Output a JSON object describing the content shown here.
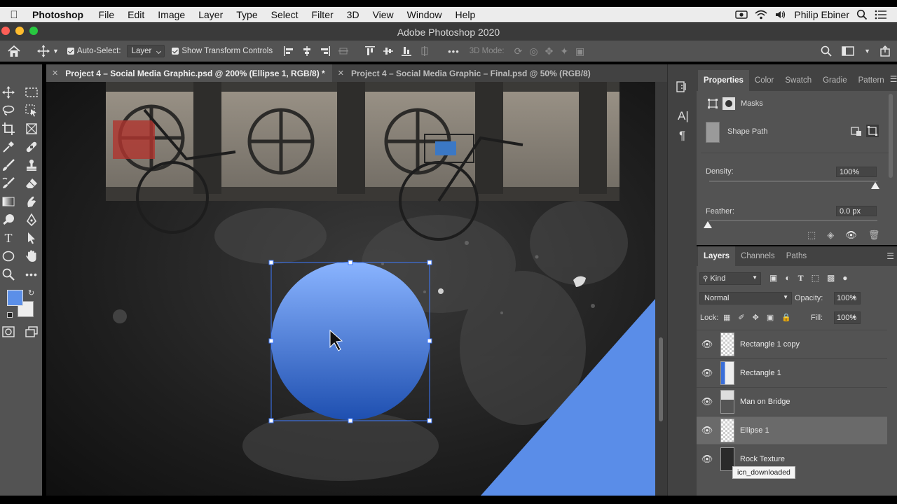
{
  "menubar": {
    "app_name": "Photoshop",
    "items": [
      "File",
      "Edit",
      "Image",
      "Layer",
      "Type",
      "Select",
      "Filter",
      "3D",
      "View",
      "Window",
      "Help"
    ],
    "user": "Philip Ebiner"
  },
  "window": {
    "title": "Adobe Photoshop 2020"
  },
  "options": {
    "auto_select_label": "Auto-Select:",
    "auto_select_value": "Layer",
    "show_transform_label": "Show Transform Controls",
    "mode_3d_label": "3D Mode:",
    "more_label": "•••"
  },
  "tabs": [
    {
      "label": "Project 4 – Social Media Graphic.psd @ 200% (Ellipse 1, RGB/8) *",
      "active": true
    },
    {
      "label": "Project 4 – Social Media Graphic – Final.psd @ 50% (RGB/8)",
      "active": false
    }
  ],
  "properties": {
    "tabs": [
      "Properties",
      "Color",
      "Swatch",
      "Gradie",
      "Pattern"
    ],
    "masks_label": "Masks",
    "shape_path_label": "Shape Path",
    "density_label": "Density:",
    "density_value": "100%",
    "feather_label": "Feather:",
    "feather_value": "0.0 px"
  },
  "layers_panel": {
    "tabs": [
      "Layers",
      "Channels",
      "Paths"
    ],
    "filter_value": "Kind",
    "blend_mode": "Normal",
    "opacity_label": "Opacity:",
    "opacity_value": "100%",
    "lock_label": "Lock:",
    "fill_label": "Fill:",
    "fill_value": "100%",
    "layers": [
      {
        "name": "Rectangle 1 copy",
        "selected": false
      },
      {
        "name": "Rectangle 1",
        "selected": false
      },
      {
        "name": "Man on Bridge",
        "selected": false
      },
      {
        "name": "Ellipse 1",
        "selected": true
      },
      {
        "name": "Rock Texture",
        "selected": false
      }
    ],
    "tooltip": "icn_downloaded"
  },
  "colors": {
    "foreground": "#5b8fe8",
    "background": "#eeeeee",
    "ellipse_top": "#8ab4ff",
    "ellipse_bottom": "#1e4fb0",
    "triangle": "#5a8de8"
  }
}
